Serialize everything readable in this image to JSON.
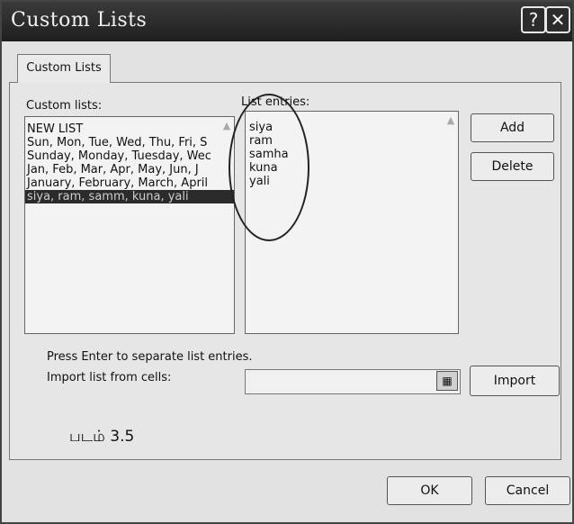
{
  "window": {
    "title": "Custom Lists",
    "help_glyph": "?",
    "close_glyph": "✕"
  },
  "tab": {
    "label": "Custom Lists"
  },
  "custom_lists": {
    "label": "Custom lists:",
    "items": [
      {
        "text": "NEW LIST",
        "selected": false
      },
      {
        "text": "Sun, Mon, Tue, Wed, Thu, Fri, S",
        "selected": false
      },
      {
        "text": "Sunday, Monday, Tuesday, Wec",
        "selected": false
      },
      {
        "text": "Jan, Feb, Mar, Apr, May, Jun, J",
        "selected": false
      },
      {
        "text": "January, February, March, April",
        "selected": false
      },
      {
        "text": "siya, ram, samm, kuna, yali",
        "selected": true
      }
    ]
  },
  "list_entries": {
    "label": "List entries:",
    "items": [
      "siya",
      "ram",
      "samha",
      "kuna",
      "yali"
    ]
  },
  "buttons": {
    "add": "Add",
    "delete": "Delete",
    "import": "Import",
    "ok": "OK",
    "cancel": "Cancel"
  },
  "hint": "Press Enter to separate list entries.",
  "import_label": "Import list from cells:",
  "import_value": "",
  "caption": "படம் 3.5"
}
